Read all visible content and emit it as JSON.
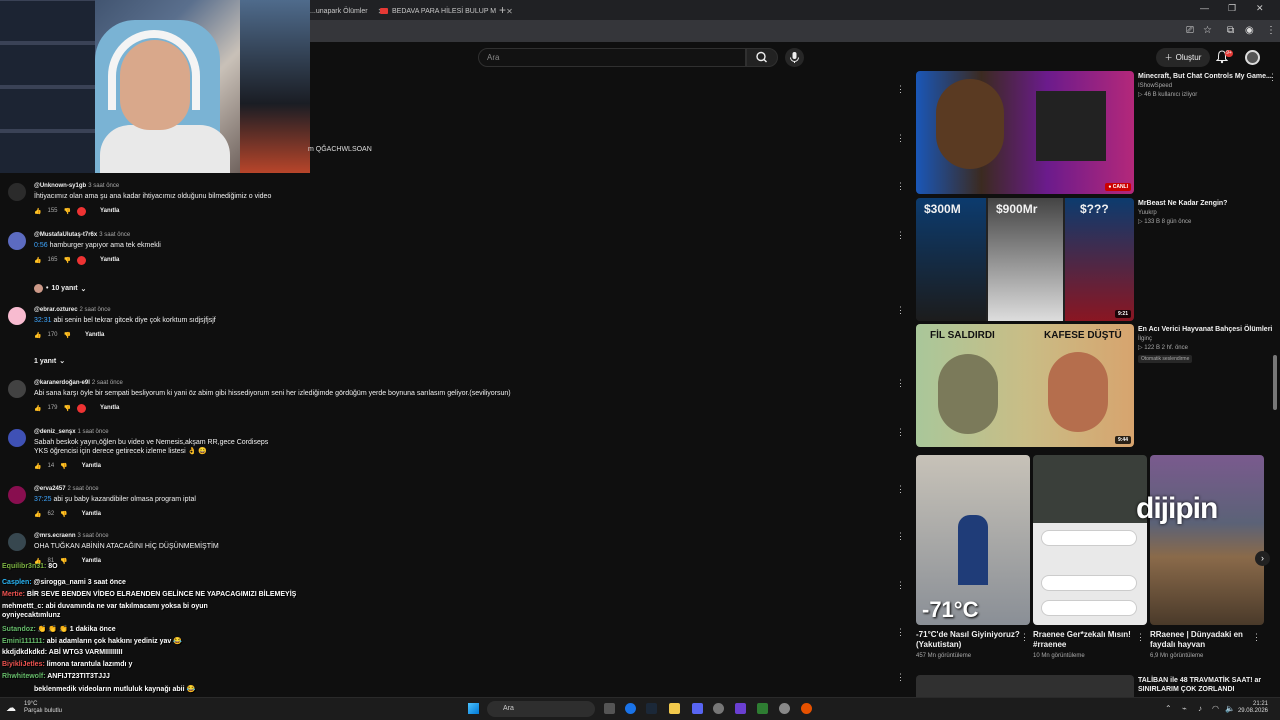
{
  "browser": {
    "tabs": [
      {
        "label": "...unapark Ölümler"
      },
      {
        "label": "BEDAVA PARA HİLESİ BULUP M"
      }
    ],
    "new_tab": "+",
    "window_controls": [
      "—",
      "❐",
      "✕"
    ]
  },
  "masthead": {
    "search_placeholder": "Ara",
    "create_label": "Oluştur",
    "notification_count": "9+"
  },
  "hidden_comment_text": "m QĞACHWLSOAN",
  "comments": [
    {
      "author": "@Unknown-sy1gb",
      "time": "3 saat önce",
      "text": "İhtiyacımız olan ama şu ana kadar ihtiyacımız olduğunu bilmediğimiz o video",
      "likes": "155",
      "reply": "Yanıtla",
      "avatar_color": "#2b2b2b"
    },
    {
      "author": "@MustafaUlutaş-t7r6x",
      "time": "3 saat önce",
      "ts": "0:56",
      "text": " hamburger yapıyor ama tek ekmekli",
      "likes": "165",
      "reply": "Yanıtla",
      "avatar_color": "#5c6bc0"
    },
    {
      "author": "@ebrar.ozturec",
      "time": "2 saat önce",
      "ts": "32:31",
      "text": " abi senin bel tekrar gitcek diye çok korktum sıdjsjfjsjf",
      "likes": "170",
      "reply": "Yanıtla",
      "avatar_color": "#f8bbd0"
    },
    {
      "author": "@karanerdoğan-e9l",
      "time": "2 saat önce",
      "text": "Abi sana karşı öyle bir sempati besliyorum ki yani öz abim gibi hissediyorum seni her izlediğimde gördüğüm yerde boynuna sarılasım geliyor.(seviliyorsun)",
      "likes": "179",
      "reply": "Yanıtla",
      "avatar_color": "#424242"
    },
    {
      "author": "@deniz_senşx",
      "time": "1 saat önce",
      "text": "Sabah beskok yayın,öğlen bu video ve Nemesis,akşam RR,gece Cordiseps",
      "text2": "YKS öğrencisi için derece getirecek izleme listesi 👌 😄",
      "likes": "14",
      "reply": "Yanıtla",
      "avatar_color": "#3f51b5"
    },
    {
      "author": "@erva2457",
      "time": "2 saat önce",
      "ts": "37:25",
      "text": " abi şu baby kazandibiler olmasa program iptal",
      "likes": "62",
      "reply": "Yanıtla",
      "avatar_color": "#880e4f"
    },
    {
      "author": "@mrs.ecraenn",
      "time": "3 saat önce",
      "text": "OHA TUĞKAN ABİNİN ATACAĞINI HİÇ DÜŞÜNMEMİŞTİM",
      "likes": "81",
      "reply": "Yanıtla",
      "avatar_color": "#37474f"
    }
  ],
  "replies_toggles": {
    "first": "10 yanıt",
    "second": "1 yanıt"
  },
  "chat": [
    {
      "user": "Equilibr3n31:",
      "msg": " 8O",
      "color": "#7cb342"
    },
    {
      "user": "Casplen:",
      "msg": " @sirogga_nami 3 saat önce",
      "color": "#29b6f6"
    },
    {
      "user": "Mertie:",
      "msg": " BİR SEVE BENDEN VİDEO ELRAENDEN GELİNCE NE YAPACAGIMIZI BİLEMEYİŞ",
      "color": "#ef5350"
    },
    {
      "user": "mehmettt_c:",
      "msg": " abi duvamında ne var takılmacamı yoksa bi oyun",
      "color": "#ffffff"
    },
    {
      "user": "oyniyecaktımlunz",
      "msg": "",
      "color": "#ffffff"
    },
    {
      "user": "Sutandoz:",
      "msg": " 👏 👏 👏 1 dakika önce",
      "color": "#66bb6a"
    },
    {
      "user": "Emini111111:",
      "msg": " abi adamların çok hakkını yediniz yav 😂",
      "color": "#66bb6a"
    },
    {
      "user": "kkdjdkdkdkd:",
      "msg": " ABİ WTG3 VARMIIIIIIIII",
      "color": "#ffffff"
    },
    {
      "user": "BiyikliJetles:",
      "msg": " limona tarantula lazımdı y",
      "color": "#ef5350"
    },
    {
      "user": "Rhwhitewolf:",
      "msg": " ANFIJT23TIT3TJJJ",
      "color": "#66bb6a"
    },
    {
      "user": "",
      "msg": "beklenmedik videoların mutluluk kaynağı abii 😂",
      "color": "#ffffff"
    }
  ],
  "videos": [
    {
      "title": "Minecraft, But Chat Controls My Game...",
      "channel": "IShowSpeed",
      "stats": "▷ 46 B kullanıcı izliyor",
      "badge": "● CANLI"
    },
    {
      "title": "MrBeast Ne Kadar Zengin?",
      "channel": "Yuukrp",
      "stats": "▷ 133 B  8 gün önce",
      "duration": "9:21",
      "labels": [
        "$300M",
        "$900Mr",
        "$???"
      ]
    },
    {
      "title": "En Acı Verici Hayvanat Bahçesi Ölümleri",
      "channel": "İlginç",
      "stats": "▷ 122 B  2 hf. önce",
      "auto": "Otomatik seslendirme",
      "duration": "9:44",
      "labels": [
        "FİL SALDIRDI",
        "KAFESE DÜŞTÜ"
      ]
    }
  ],
  "shorts": [
    {
      "title": "-71°C'de Nasıl Giyiniyoruz? (Yakutistan)",
      "views": "457 Mn görüntüleme",
      "overlay": "-71°C"
    },
    {
      "title": "Rraenee Ger*zekalı Mısın! #rraenee",
      "views": "10 Mn görüntüleme"
    },
    {
      "title": "RRaenee | Dünyadaki en faydalı hayvan",
      "views": "6,9 Mn görüntüleme"
    }
  ],
  "watermark": "dijipin",
  "bottom_video": {
    "title": "TALİBAN ile 48 TRAVMATİK SAAT! ar SINIRLARIM ÇOK ZORLANDI"
  },
  "taskbar": {
    "temp": "19°C",
    "weather": "Parçalı bulutlu",
    "search": "Ara",
    "time": "21:21",
    "date": "29.08.2026"
  }
}
